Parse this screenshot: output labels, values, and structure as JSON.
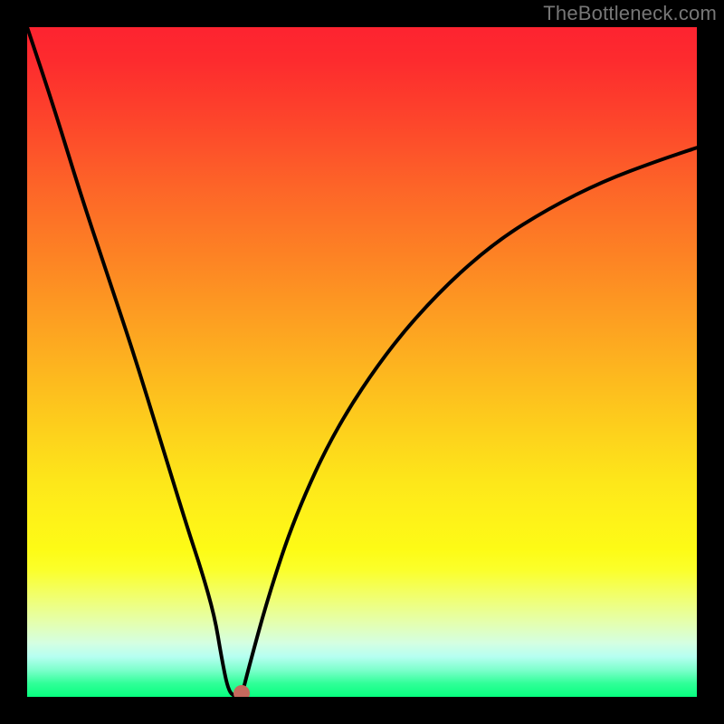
{
  "watermark": "TheBottleneck.com",
  "chart_data": {
    "type": "line",
    "title": "",
    "xlabel": "",
    "ylabel": "",
    "xlim": [
      0,
      100
    ],
    "ylim": [
      0,
      100
    ],
    "series": [
      {
        "name": "curve",
        "x": [
          0,
          4,
          8,
          12,
          16,
          20,
          24,
          26,
          28,
          29,
          30,
          31,
          32,
          33,
          36,
          40,
          46,
          54,
          62,
          70,
          78,
          86,
          94,
          100
        ],
        "y": [
          100,
          88,
          75,
          63,
          51,
          38,
          25,
          19,
          12,
          6,
          1,
          0,
          0,
          4,
          15,
          27,
          40,
          52,
          61,
          68,
          73,
          77,
          80,
          82
        ]
      }
    ],
    "marker": {
      "x": 32,
      "y": 0.5
    },
    "colors": {
      "curve": "#000000",
      "marker": "#c6695d",
      "gradient_top": "#fd2330",
      "gradient_bottom": "#07ff7f",
      "frame": "#000000"
    }
  }
}
